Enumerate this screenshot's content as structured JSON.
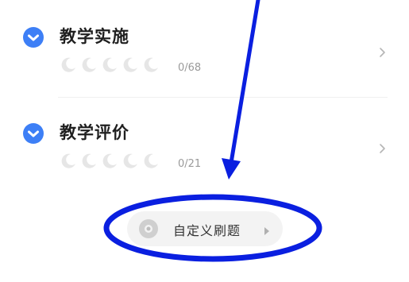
{
  "sections": [
    {
      "title": "教学实施",
      "progress_text": "0/68",
      "progress_fraction": 0,
      "moon_slots": 5,
      "icon": "check-circle-icon",
      "chevron_icon": "chevron-right-icon"
    },
    {
      "title": "教学评价",
      "progress_text": "0/21",
      "progress_fraction": 0,
      "moon_slots": 5,
      "icon": "check-circle-icon",
      "chevron_icon": "chevron-right-icon"
    }
  ],
  "custom_practice": {
    "label": "自定义刷题",
    "icon": "disc-icon",
    "arrow_icon": "play-triangle-icon"
  },
  "annotation": {
    "color": "#0a1fe0",
    "shapes": [
      "arrow",
      "ellipse"
    ]
  },
  "colors": {
    "accent": "#3d7ff6",
    "moon": "#e6e6e6",
    "muted_text": "#9a9a9a",
    "button_bg": "#f3f3f3"
  }
}
